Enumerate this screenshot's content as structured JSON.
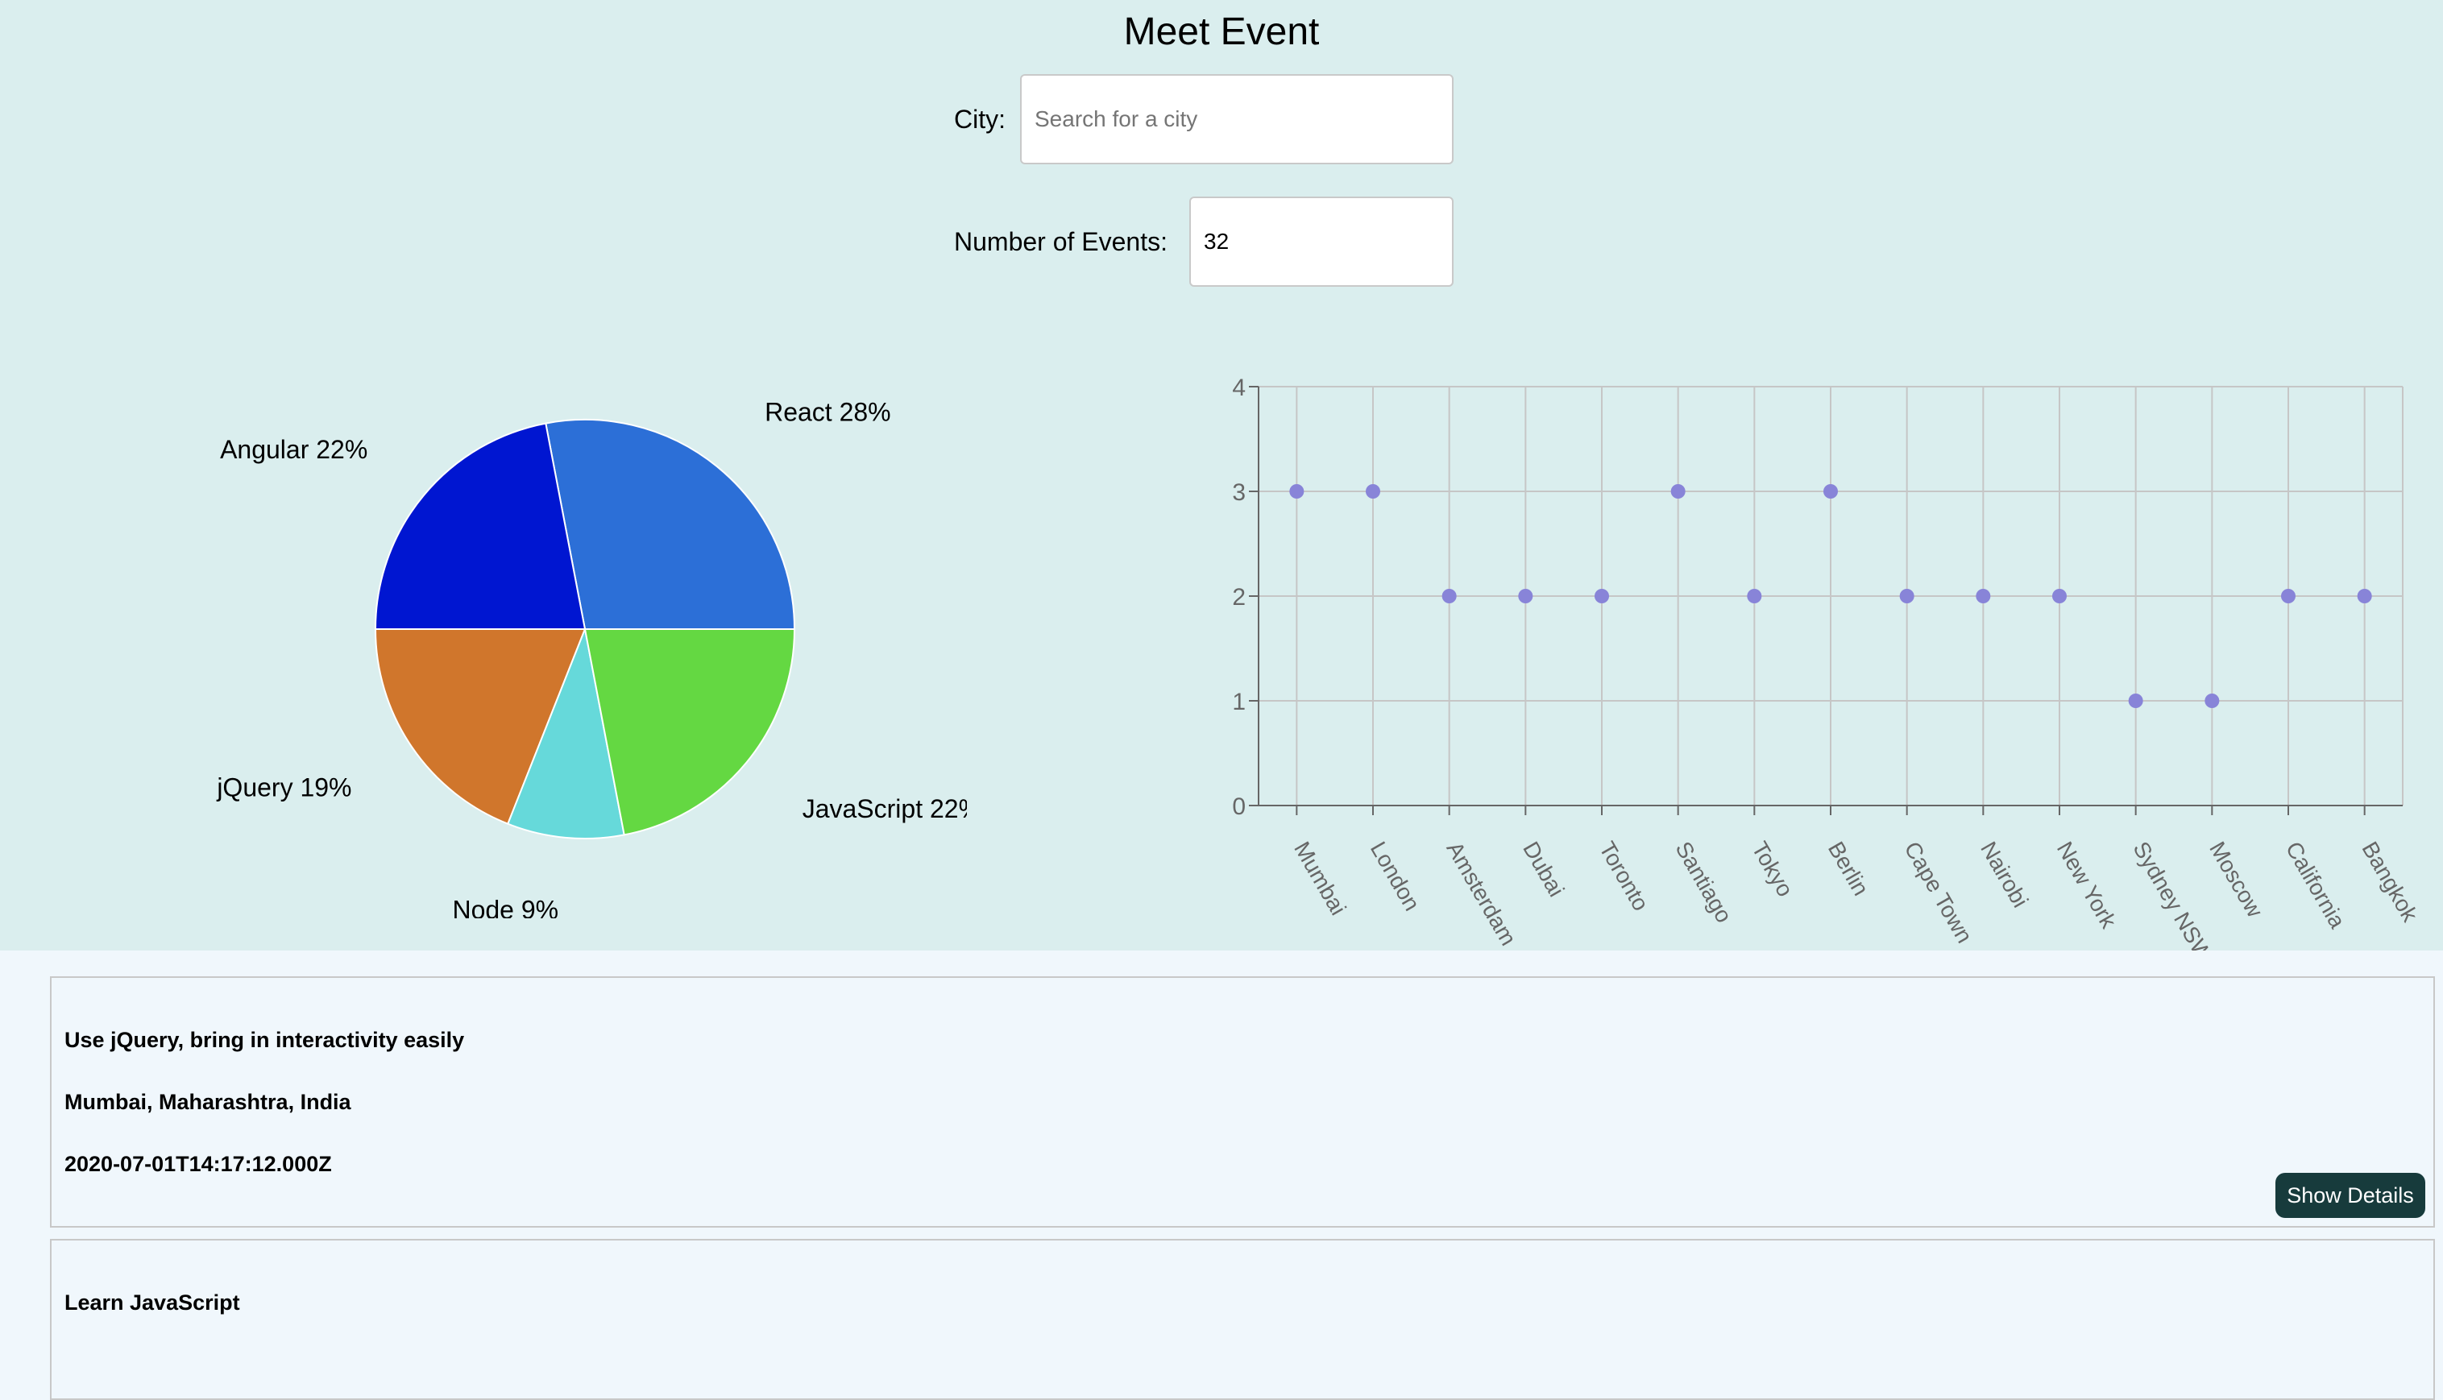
{
  "app": {
    "title": "Meet Event"
  },
  "city_search": {
    "label": "City:",
    "placeholder": "Search for a city",
    "value": ""
  },
  "number_of_events": {
    "label": "Number of Events:",
    "value": "32"
  },
  "chart_data": [
    {
      "type": "pie",
      "slices": [
        {
          "label": "React",
          "value": 28,
          "color": "#2c6fd7"
        },
        {
          "label": "Angular",
          "value": 22,
          "color": "#0016d1"
        },
        {
          "label": "jQuery",
          "value": 19,
          "color": "#d0762c"
        },
        {
          "label": "Node",
          "value": 9,
          "color": "#66d9da"
        },
        {
          "label": "JavaScript",
          "value": 22,
          "color": "#64d842"
        }
      ],
      "label_format": "{label} {value}%"
    },
    {
      "type": "scatter",
      "categories": [
        "Mumbai",
        "London",
        "Amsterdam",
        "Dubai",
        "Toronto",
        "Santiago",
        "Tokyo",
        "Berlin",
        "Cape Town",
        "Nairobi",
        "New York",
        "Sydney NSW",
        "Moscow",
        "California",
        "Bangkok"
      ],
      "values": [
        3,
        3,
        2,
        2,
        2,
        3,
        2,
        3,
        2,
        2,
        2,
        1,
        1,
        2,
        2
      ],
      "yticks": [
        0,
        1,
        2,
        3,
        4
      ],
      "ylim": [
        0,
        4
      ],
      "grid": true,
      "point_color": "#8884d8"
    }
  ],
  "events": [
    {
      "summary": "Use jQuery, bring in interactivity easily",
      "location": "Mumbai, Maharashtra, India",
      "datetime": "2020-07-01T14:17:12.000Z",
      "button_label": "Show Details"
    },
    {
      "summary": "Learn JavaScript"
    }
  ]
}
